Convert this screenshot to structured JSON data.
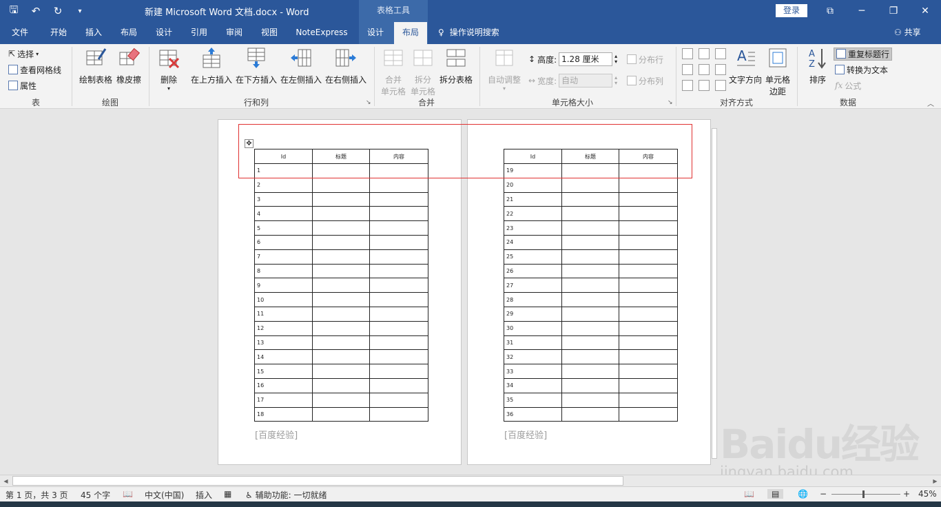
{
  "titlebar": {
    "qat_icons": [
      "save-icon",
      "undo-icon",
      "redo-icon",
      "customize-icon"
    ],
    "doc_title": "新建 Microsoft Word 文档.docx  -  Word",
    "context_group": "表格工具",
    "login": "登录"
  },
  "tabs": [
    {
      "label": "文件"
    },
    {
      "label": "开始"
    },
    {
      "label": "插入"
    },
    {
      "label": "布局"
    },
    {
      "label": "设计"
    },
    {
      "label": "引用"
    },
    {
      "label": "审阅"
    },
    {
      "label": "视图"
    },
    {
      "label": "NoteExpress"
    },
    {
      "label": "设计"
    },
    {
      "label": "布局"
    }
  ],
  "tell_me": "操作说明搜索",
  "share": "共享",
  "ribbon": {
    "table_group": {
      "label": "表",
      "select": "选择",
      "gridlines": "查看网格线",
      "properties": "属性"
    },
    "draw_group": {
      "label": "绘图",
      "draw_table": "绘制表格",
      "eraser": "橡皮擦"
    },
    "rows_group": {
      "label": "行和列",
      "delete": "删除",
      "insert_above": "在上方插入",
      "insert_below": "在下方插入",
      "insert_left": "在左侧插入",
      "insert_right": "在右侧插入"
    },
    "merge_group": {
      "label": "合并",
      "merge_cells_1": "合并",
      "merge_cells_2": "单元格",
      "split_cells_1": "拆分",
      "split_cells_2": "单元格",
      "split_table": "拆分表格"
    },
    "size_group": {
      "label": "单元格大小",
      "autofit": "自动调整",
      "height_label": "高度:",
      "height_value": "1.28 厘米",
      "width_label": "宽度:",
      "width_value": "自动",
      "distribute_rows": "分布行",
      "distribute_cols": "分布列"
    },
    "align_group": {
      "label": "对齐方式",
      "text_direction": "文字方向",
      "cell_margins_1": "单元格",
      "cell_margins_2": "边距"
    },
    "data_group": {
      "label": "数据",
      "sort": "排序",
      "repeat_header": "重复标题行",
      "convert_text": "转换为文本",
      "formula": "公式"
    }
  },
  "document": {
    "headers": [
      "Id",
      "标题",
      "内容"
    ],
    "page1_rows": [
      "1",
      "2",
      "3",
      "4",
      "5",
      "6",
      "7",
      "8",
      "9",
      "10",
      "11",
      "12",
      "13",
      "14",
      "15",
      "16",
      "17",
      "18"
    ],
    "page2_rows": [
      "19",
      "20",
      "21",
      "22",
      "23",
      "24",
      "25",
      "26",
      "27",
      "28",
      "29",
      "30",
      "31",
      "32",
      "33",
      "34",
      "35",
      "36"
    ],
    "footer_text": "[百度经验]"
  },
  "watermark": {
    "logo": "Baidu经验",
    "url": "jingyan.baidu.com"
  },
  "statusbar": {
    "page": "第 1 页，共 3 页",
    "words": "45 个字",
    "language": "中文(中国)",
    "mode": "插入",
    "accessibility": "辅助功能: 一切就绪",
    "zoom": "45%"
  },
  "colors": {
    "accent": "#2b579a",
    "context_tab": "#3c6aa9",
    "highlight_box": "#e03030"
  }
}
